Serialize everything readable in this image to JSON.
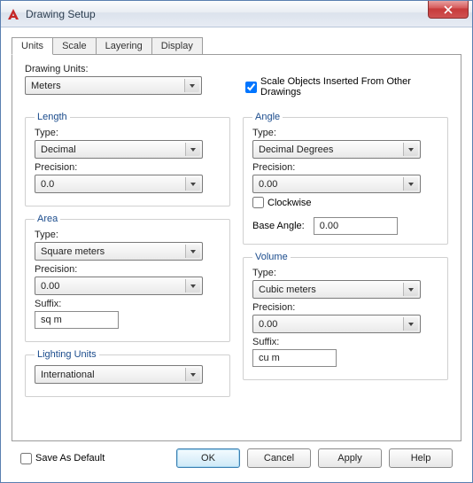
{
  "window": {
    "title": "Drawing Setup"
  },
  "tabs": [
    "Units",
    "Scale",
    "Layering",
    "Display"
  ],
  "active_tab": 0,
  "drawing_units": {
    "label": "Drawing Units:",
    "value": "Meters"
  },
  "scale_objects": {
    "label": "Scale Objects Inserted From Other Drawings",
    "checked": true
  },
  "length": {
    "legend": "Length",
    "type_label": "Type:",
    "type_value": "Decimal",
    "precision_label": "Precision:",
    "precision_value": "0.0"
  },
  "angle": {
    "legend": "Angle",
    "type_label": "Type:",
    "type_value": "Decimal Degrees",
    "precision_label": "Precision:",
    "precision_value": "0.00",
    "clockwise_label": "Clockwise",
    "clockwise_checked": false,
    "base_angle_label": "Base Angle:",
    "base_angle_value": "0.00"
  },
  "area": {
    "legend": "Area",
    "type_label": "Type:",
    "type_value": "Square meters",
    "precision_label": "Precision:",
    "precision_value": "0.00",
    "suffix_label": "Suffix:",
    "suffix_value": "sq m"
  },
  "volume": {
    "legend": "Volume",
    "type_label": "Type:",
    "type_value": "Cubic meters",
    "precision_label": "Precision:",
    "precision_value": "0.00",
    "suffix_label": "Suffix:",
    "suffix_value": "cu m"
  },
  "lighting": {
    "legend": "Lighting Units",
    "value": "International"
  },
  "save_as_default": {
    "label": "Save As Default",
    "checked": false
  },
  "buttons": {
    "ok": "OK",
    "cancel": "Cancel",
    "apply": "Apply",
    "help": "Help"
  }
}
